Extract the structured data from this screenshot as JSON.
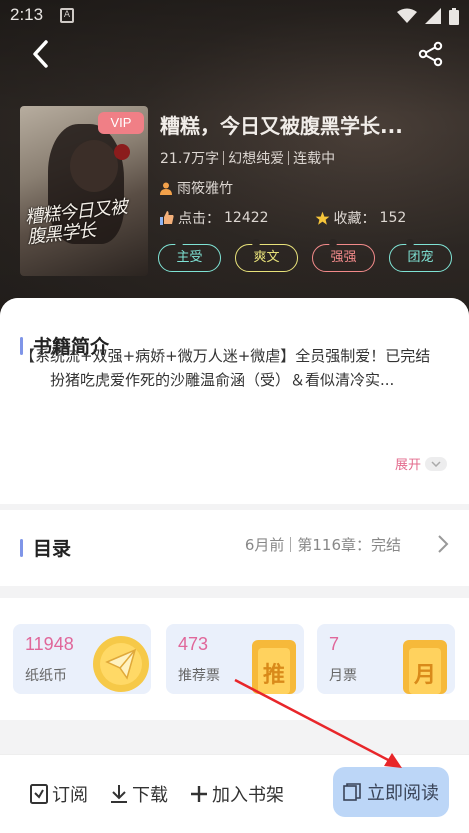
{
  "status_bar": {
    "time": "2:13",
    "a_icon": "A"
  },
  "nav": {
    "back_icon": "back-arrow-icon",
    "share_icon": "share-icon"
  },
  "book": {
    "vip_label": "VIP",
    "cover_title": "糟糕今日又被腹黑学长",
    "title": "糟糕，今日又被腹黑学长...",
    "word_count": "21.7万字",
    "genre": "幻想纯爱",
    "serial_status": "连载中",
    "author": "雨筱雅竹",
    "clicks_label": "点击：",
    "clicks_value": "12422",
    "favorites_label": "收藏：",
    "favorites_value": "152"
  },
  "tags": [
    {
      "label": "主受",
      "color": "#7fe3d5"
    },
    {
      "label": "爽文",
      "color": "#e8e27a"
    },
    {
      "label": "强强",
      "color": "#f28a8a"
    },
    {
      "label": "团宠",
      "color": "#7fe3d5"
    }
  ],
  "intro": {
    "heading": "书籍简介",
    "paragraph1": "【系统流+双强+病娇+微万人迷+微虐】全员强制爱！已完结",
    "paragraph2": "扮猪吃虎爱作死的沙雕温俞涵（受）＆看似清冷实...",
    "expand_label": "展开"
  },
  "toc": {
    "heading": "目录",
    "updated": "6月前",
    "latest_chapter": "第116章：完结"
  },
  "currencies": [
    {
      "value": "11948",
      "label": "纸纸币",
      "icon": "paper-plane-coin-icon"
    },
    {
      "value": "473",
      "label": "推荐票",
      "icon": "recommend-ticket-icon",
      "icon_text": "推"
    },
    {
      "value": "7",
      "label": "月票",
      "icon": "monthly-ticket-icon",
      "icon_text": "月"
    }
  ],
  "bottom_bar": {
    "subscribe_label": "订阅",
    "download_label": "下载",
    "add_shelf_label": "加入书架",
    "read_now_label": "立即阅读"
  },
  "colors": {
    "accent_pink": "#e0679a",
    "read_button": "#bcd6f7",
    "vip": "#f07f86",
    "section_bar": "#7f95e8"
  }
}
